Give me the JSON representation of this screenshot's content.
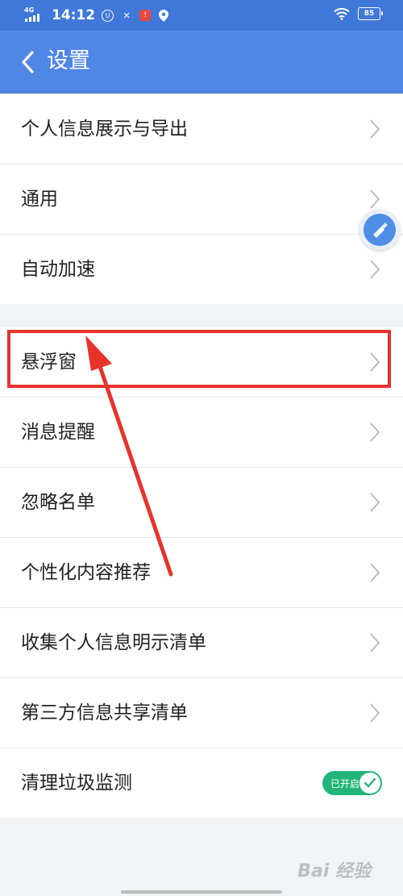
{
  "status_bar": {
    "network": "4G",
    "time": "14:12",
    "battery": "85"
  },
  "header": {
    "title": "设置"
  },
  "groups": [
    {
      "items": [
        {
          "label": "个人信息展示与导出"
        },
        {
          "label": "通用"
        },
        {
          "label": "自动加速"
        }
      ]
    },
    {
      "items": [
        {
          "label": "悬浮窗"
        },
        {
          "label": "消息提醒"
        },
        {
          "label": "忽略名单"
        },
        {
          "label": "个性化内容推荐"
        },
        {
          "label": "收集个人信息明示清单"
        },
        {
          "label": "第三方信息共享清单"
        },
        {
          "label": "清理垃圾监测",
          "toggle": {
            "text": "已开启",
            "on": true
          }
        }
      ]
    }
  ],
  "watermark": "Bai 经验",
  "colors": {
    "header": "#5086e6",
    "status_bar": "#3f78d8",
    "highlight": "#e8322c",
    "toggle_on": "#22b57a"
  },
  "icons": [
    "back-chevron-icon",
    "chevron-right-icon",
    "floating-ball-icon",
    "check-icon",
    "wifi-icon",
    "battery-icon",
    "signal-icon"
  ]
}
